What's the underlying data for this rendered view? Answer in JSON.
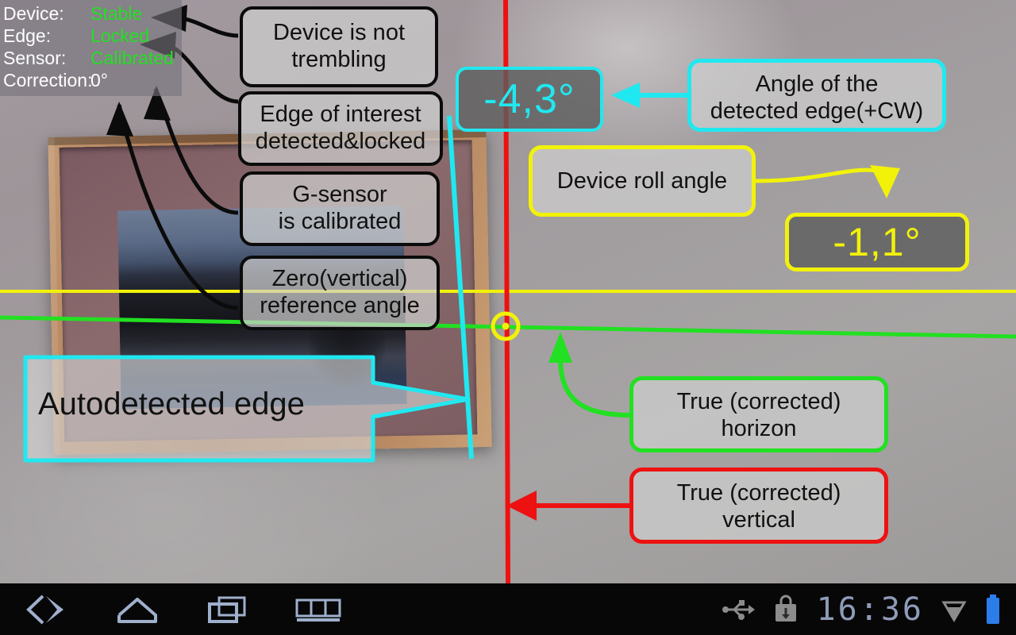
{
  "app": {
    "title": "Camera level / edge detector viewfinder"
  },
  "status_panel": {
    "rows": [
      {
        "key": "Device:",
        "value": "Stable",
        "state": "ok"
      },
      {
        "key": "Edge:",
        "value": "Locked",
        "state": "ok"
      },
      {
        "key": "Sensor:",
        "value": "Calibrated",
        "state": "ok"
      },
      {
        "key": "Correction:",
        "value": "0°",
        "state": "plain"
      }
    ]
  },
  "readouts": {
    "edge_angle": {
      "value": "-4,3°",
      "color": "#20e8f0"
    },
    "roll_angle": {
      "value": "-1,1°",
      "color": "#f2f209"
    }
  },
  "callouts": {
    "device_trembling": {
      "line1": "Device is not",
      "line2": "trembling",
      "color": "#0b0b0b"
    },
    "edge_interest": {
      "line1": "Edge of interest",
      "line2": "detected&locked",
      "color": "#0b0b0b"
    },
    "g_sensor": {
      "line1": "G-sensor",
      "line2": "is calibrated",
      "color": "#0b0b0b"
    },
    "zero_reference": {
      "line1": "Zero(vertical)",
      "line2": "reference angle",
      "color": "#0b0b0b"
    },
    "angle_detected": {
      "line1": "Angle of the",
      "line2": "detected edge(+CW)",
      "color": "#20e8f0"
    },
    "device_roll": {
      "line1": "Device roll angle",
      "line2": "",
      "color": "#f2f209"
    },
    "true_horizon": {
      "line1": "True (corrected)",
      "line2": "horizon",
      "color": "#22e022"
    },
    "true_vertical": {
      "line1": "True (corrected)",
      "line2": "vertical",
      "color": "#ee1111"
    },
    "autodetected_edge": {
      "line1": "Autodetected edge",
      "line2": "",
      "color": "#20e8f0"
    }
  },
  "guides": {
    "detected_edge_line_color": "#20e8f0",
    "true_vertical_line_color": "#ee1111",
    "true_horizon_line_color": "#22e022",
    "zero_reference_line_color": "#f2f209",
    "center_marker_color": "#f2f209"
  },
  "navbar": {
    "buttons": [
      {
        "name": "back-button",
        "icon": "back-chevron-icon"
      },
      {
        "name": "home-button",
        "icon": "home-icon"
      },
      {
        "name": "recents-button",
        "icon": "recents-icon"
      },
      {
        "name": "menu-button",
        "icon": "grid-menu-icon"
      }
    ],
    "status": {
      "usb_icon": "usb-icon",
      "download_icon": "download-bag-icon",
      "clock": "16:36",
      "wifi_icon": "wifi-icon",
      "battery_icon": "battery-icon",
      "battery_color": "#2b7de9"
    }
  }
}
